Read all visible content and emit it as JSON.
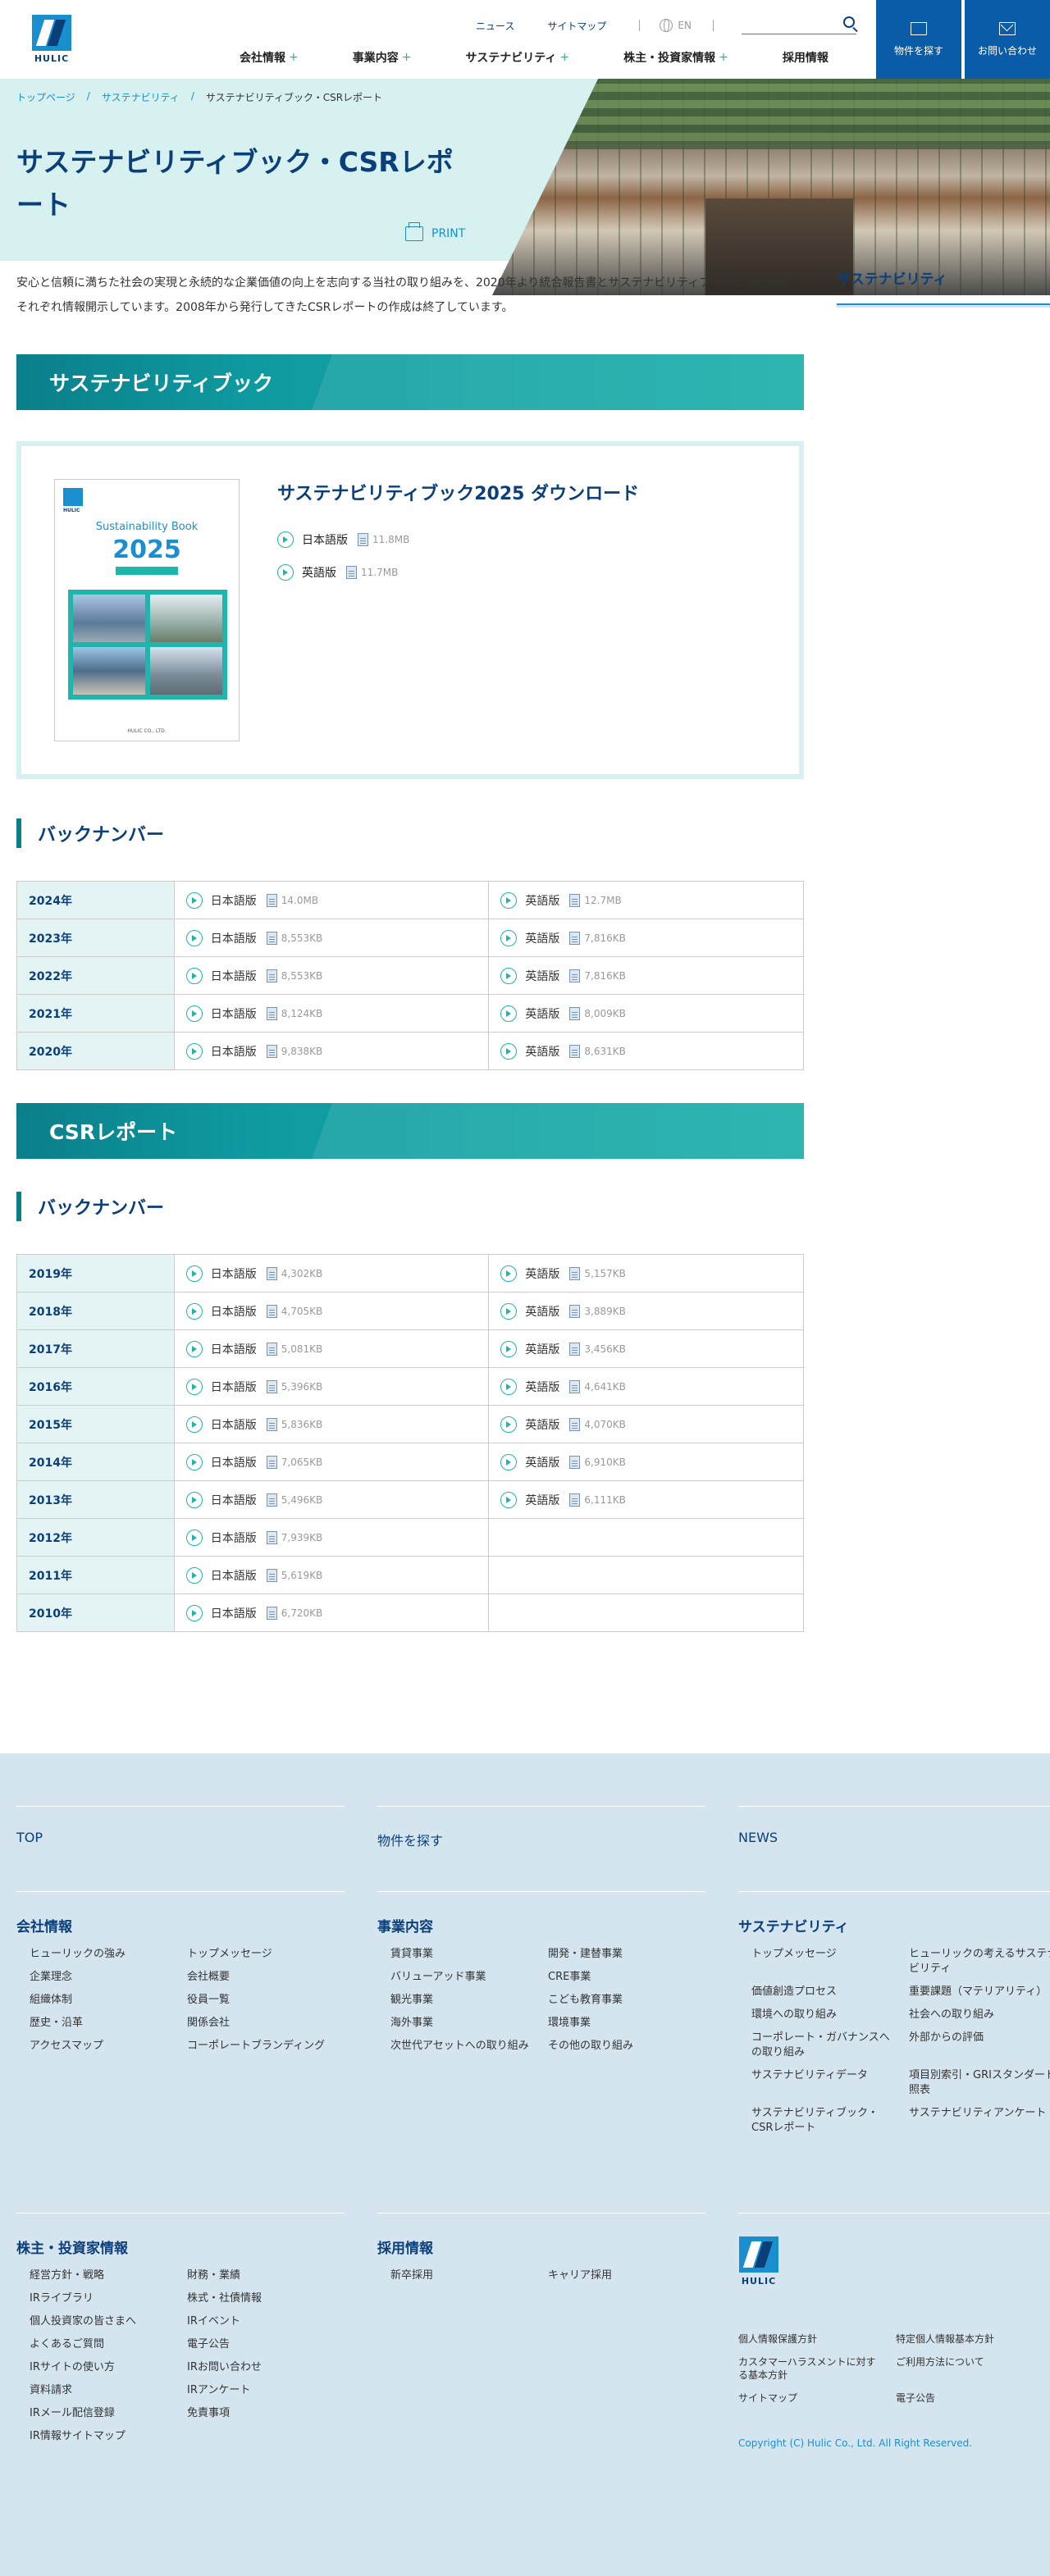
{
  "header": {
    "logo_text": "HULIC",
    "util": [
      "ニュース",
      "サイトマップ"
    ],
    "lang": "EN",
    "search_placeholder": "",
    "nav": [
      {
        "label": "会社情報",
        "plus": "+"
      },
      {
        "label": "事業内容",
        "plus": "+"
      },
      {
        "label": "サステナビリティ",
        "plus": "+"
      },
      {
        "label": "株主・投資家情報",
        "plus": "+"
      },
      {
        "label": "採用情報",
        "plus": ""
      }
    ],
    "cta_search": "物件を探す",
    "cta_contact": "お問い合わせ"
  },
  "breadcrumb": {
    "home": "トップページ",
    "parent": "サステナビリティ",
    "current": "サステナビリティブック・CSRレポート",
    "sep": "/"
  },
  "page_title": "サステナビリティブック・CSRレポート",
  "print_label": "PRINT",
  "sidebar_title": "サステナビリティ",
  "intro": "安心と信頼に満ちた社会の実現と永続的な企業価値の向上を志向する当社の取り組みを、2020年より統合報告書とサステナビリティブックにまとめて、それぞれ情報開示しています。2008年から発行してきたCSRレポートの作成は終了しています。",
  "sustainability_section": {
    "heading": "サステナビリティブック",
    "book": {
      "cover_title": "Sustainability Book",
      "cover_year": "2025",
      "cover_foot": "HULIC CO., LTD.",
      "title": "サステナビリティブック2025 ダウンロード",
      "downloads": [
        {
          "label": "日本語版",
          "size": "11.8MB"
        },
        {
          "label": "英語版",
          "size": "11.7MB"
        }
      ]
    },
    "backnumber_heading": "バックナンバー",
    "backnumbers": [
      {
        "year": "2024年",
        "ja": "日本語版",
        "ja_size": "14.0MB",
        "en": "英語版",
        "en_size": "12.7MB"
      },
      {
        "year": "2023年",
        "ja": "日本語版",
        "ja_size": "8,553KB",
        "en": "英語版",
        "en_size": "7,816KB"
      },
      {
        "year": "2022年",
        "ja": "日本語版",
        "ja_size": "8,553KB",
        "en": "英語版",
        "en_size": "7,816KB"
      },
      {
        "year": "2021年",
        "ja": "日本語版",
        "ja_size": "8,124KB",
        "en": "英語版",
        "en_size": "8,009KB"
      },
      {
        "year": "2020年",
        "ja": "日本語版",
        "ja_size": "9,838KB",
        "en": "英語版",
        "en_size": "8,631KB"
      }
    ]
  },
  "csr_section": {
    "heading": "CSRレポート",
    "backnumber_heading": "バックナンバー",
    "backnumbers": [
      {
        "year": "2019年",
        "ja": "日本語版",
        "ja_size": "4,302KB",
        "en": "英語版",
        "en_size": "5,157KB"
      },
      {
        "year": "2018年",
        "ja": "日本語版",
        "ja_size": "4,705KB",
        "en": "英語版",
        "en_size": "3,889KB"
      },
      {
        "year": "2017年",
        "ja": "日本語版",
        "ja_size": "5,081KB",
        "en": "英語版",
        "en_size": "3,456KB"
      },
      {
        "year": "2016年",
        "ja": "日本語版",
        "ja_size": "5,396KB",
        "en": "英語版",
        "en_size": "4,641KB"
      },
      {
        "year": "2015年",
        "ja": "日本語版",
        "ja_size": "5,836KB",
        "en": "英語版",
        "en_size": "4,070KB"
      },
      {
        "year": "2014年",
        "ja": "日本語版",
        "ja_size": "7,065KB",
        "en": "英語版",
        "en_size": "6,910KB"
      },
      {
        "year": "2013年",
        "ja": "日本語版",
        "ja_size": "5,496KB",
        "en": "英語版",
        "en_size": "6,111KB"
      },
      {
        "year": "2012年",
        "ja": "日本語版",
        "ja_size": "7,939KB",
        "en": "",
        "en_size": ""
      },
      {
        "year": "2011年",
        "ja": "日本語版",
        "ja_size": "5,619KB",
        "en": "",
        "en_size": ""
      },
      {
        "year": "2010年",
        "ja": "日本語版",
        "ja_size": "6,720KB",
        "en": "",
        "en_size": ""
      }
    ]
  },
  "footer": {
    "top_links": [
      "TOP",
      "物件を探す",
      "NEWS"
    ],
    "groups": [
      {
        "title": "会社情報",
        "links": [
          "ヒューリックの強み",
          "トップメッセージ",
          "企業理念",
          "会社概要",
          "組織体制",
          "役員一覧",
          "歴史・沿革",
          "関係会社",
          "アクセスマップ",
          "コーポレートブランディング"
        ]
      },
      {
        "title": "事業内容",
        "links": [
          "賃貸事業",
          "開発・建替事業",
          "バリューアッド事業",
          "CRE事業",
          "観光事業",
          "こども教育事業",
          "海外事業",
          "環境事業",
          "次世代アセットへの取り組み",
          "その他の取り組み"
        ]
      },
      {
        "title": "サステナビリティ",
        "links": [
          "トップメッセージ",
          "ヒューリックの考えるサステナビリティ",
          "価値創造プロセス",
          "重要課題（マテリアリティ）",
          "環境への取り組み",
          "社会への取り組み",
          "コーポレート・ガバナンスへの取り組み",
          "外部からの評価",
          "サステナビリティデータ",
          "項目別索引・GRIスタンダード対照表",
          "サステナビリティブック・CSRレポート",
          "サステナビリティアンケート"
        ]
      },
      {
        "title": "株主・投資家情報",
        "links": [
          "経営方針・戦略",
          "財務・業績",
          "IRライブラリ",
          "株式・社債情報",
          "個人投資家の皆さまへ",
          "IRイベント",
          "よくあるご質問",
          "電子公告",
          "IRサイトの使い方",
          "IRお問い合わせ",
          "資料請求",
          "IRアンケート",
          "IRメール配信登録",
          "免責事項",
          "IR情報サイトマップ"
        ]
      },
      {
        "title": "採用情報",
        "links": [
          "新卒採用",
          "キャリア採用"
        ]
      }
    ],
    "logo_text": "HULIC",
    "legal": [
      "個人情報保護方針",
      "特定個人情報基本方針",
      "カスタマーハラスメントに対する基本方針",
      "ご利用方法について",
      "サイトマップ",
      "電子公告"
    ],
    "copyright": "Copyright (C) Hulic Co., Ltd. All Right Reserved."
  },
  "colors": {
    "navy": "#0b3f7a",
    "blue": "#1a8fcf",
    "teal": "#0f9aa0",
    "footer_bg": "#d5e5ef"
  }
}
